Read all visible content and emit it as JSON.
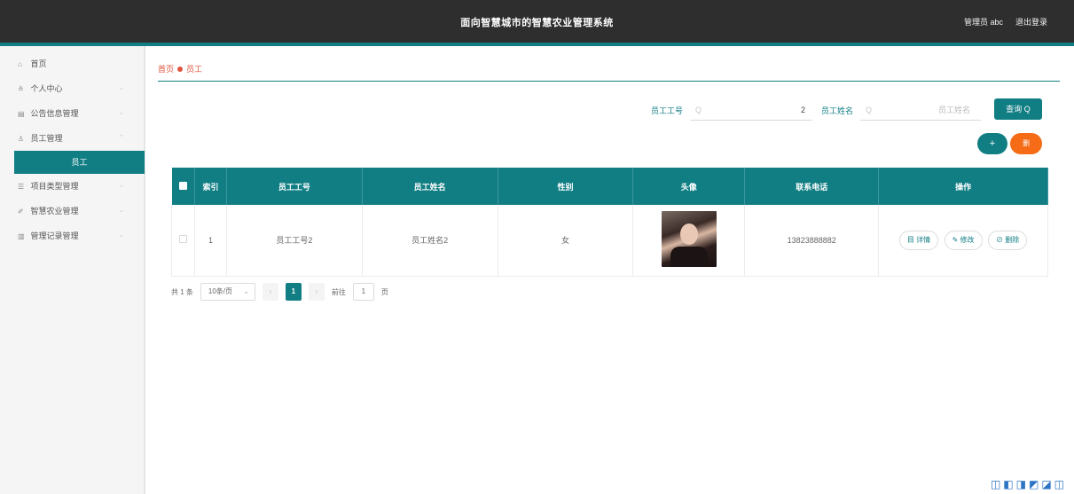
{
  "header": {
    "title": "面向智慧城市的智慧农业管理系统",
    "user_label": "管理员 abc",
    "logout_label": "退出登录"
  },
  "sidebar": {
    "items": [
      {
        "label": "首页",
        "icon": "home-icon",
        "glyph": "⌂",
        "chevron": false
      },
      {
        "label": "个人中心",
        "icon": "user-icon",
        "glyph": "≗",
        "chevron": true
      },
      {
        "label": "公告信息管理",
        "icon": "notice-icon",
        "glyph": "▤",
        "chevron": true
      },
      {
        "label": "员工管理",
        "icon": "staff-icon",
        "glyph": "♙",
        "chevron": true
      },
      {
        "label": "项目类型管理",
        "icon": "project-type-icon",
        "glyph": "☰",
        "chevron": true
      },
      {
        "label": "智慧农业管理",
        "icon": "leaf-icon",
        "glyph": "✐",
        "chevron": true
      },
      {
        "label": "管理记录管理",
        "icon": "record-icon",
        "glyph": "▥",
        "chevron": true
      }
    ],
    "active_sub": "员工"
  },
  "breadcrumb": {
    "home": "首页",
    "current": "员工"
  },
  "search": {
    "field1_label": "员工工号",
    "field1_value": "2",
    "field2_label": "员工姓名",
    "field2_placeholder": "员工姓名",
    "query_label": "查询 Q"
  },
  "actions": {
    "add_label": "+",
    "delete_label": "删"
  },
  "table": {
    "headers": [
      "索引",
      "员工工号",
      "员工姓名",
      "性别",
      "头像",
      "联系电话",
      "操作"
    ],
    "rows": [
      {
        "index": "1",
        "employee_no": "员工工号2",
        "employee_name": "员工姓名2",
        "gender": "女",
        "phone": "13823888882"
      }
    ],
    "ops": {
      "view": "目 详情",
      "edit": "✎ 修改",
      "delete": "⊘ 删除"
    }
  },
  "pagination": {
    "total": "共 1 条",
    "page_size": "10条/页",
    "current_page": "1",
    "goto_label": "前往",
    "goto_value": "1",
    "page_suffix": "页"
  },
  "colors": {
    "accent": "#117e84",
    "danger": "#f56b16",
    "header_bg": "#2e2e2e"
  }
}
